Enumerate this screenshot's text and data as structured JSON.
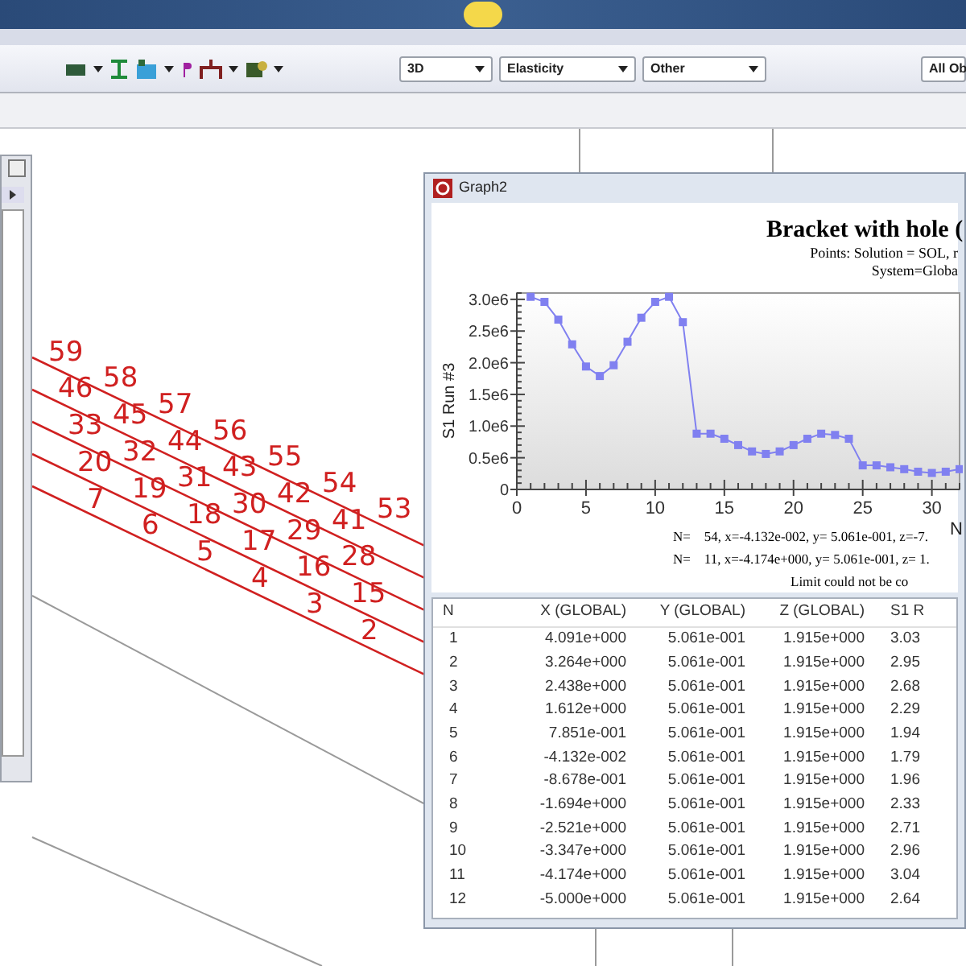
{
  "toolbar": {
    "dropdowns": [
      {
        "value": "3D"
      },
      {
        "value": "Elasticity"
      },
      {
        "value": "Other"
      },
      {
        "value": "All Ob"
      }
    ]
  },
  "viewport": {
    "node_label_rows": [
      [
        "59",
        "58",
        "57",
        "56",
        "55",
        "54",
        "53"
      ],
      [
        "46",
        "45",
        "44",
        "43",
        "42",
        "41"
      ],
      [
        "33",
        "32",
        "31",
        "30",
        "29",
        "28"
      ],
      [
        "20",
        "19",
        "18",
        "17",
        "16",
        "15"
      ],
      [
        "7",
        "6",
        "5",
        "4",
        "3",
        "2"
      ]
    ]
  },
  "graph_window": {
    "title": "Graph2",
    "heading": "Bracket with hole  (",
    "subtitle_lines": [
      "Points: Solution = SOL, r",
      "System=Globa"
    ],
    "chart_data": {
      "type": "line",
      "xlabel": "N",
      "ylabel": "S1 Run #3",
      "x": [
        1,
        2,
        3,
        4,
        5,
        6,
        7,
        8,
        9,
        10,
        11,
        12,
        13,
        14,
        15,
        16,
        17,
        18,
        19,
        20,
        21,
        22,
        23,
        24,
        25,
        26,
        27,
        28,
        29,
        30,
        31,
        32
      ],
      "series": [
        {
          "color": "#8080f0",
          "marker": "square",
          "values": [
            3040000,
            2960000,
            2680000,
            2290000,
            1940000,
            1790000,
            1960000,
            2330000,
            2710000,
            2960000,
            3040000,
            2640000,
            880000,
            880000,
            800000,
            700000,
            600000,
            560000,
            600000,
            700000,
            800000,
            880000,
            860000,
            800000,
            380000,
            380000,
            350000,
            320000,
            280000,
            260000,
            280000,
            320000
          ]
        }
      ],
      "xlim": [
        0,
        32
      ],
      "ylim": [
        0,
        3100000
      ],
      "xticks": [
        0,
        5,
        10,
        15,
        20,
        25,
        30
      ],
      "yticks": [
        {
          "value": 0,
          "label": "0"
        },
        {
          "value": 500000,
          "label": "0.5e6"
        },
        {
          "value": 1000000,
          "label": "1.0e6"
        },
        {
          "value": 1500000,
          "label": "1.5e6"
        },
        {
          "value": 2000000,
          "label": "2.0e6"
        },
        {
          "value": 2500000,
          "label": "2.5e6"
        },
        {
          "value": 3000000,
          "label": "3.0e6"
        }
      ]
    },
    "readouts": [
      "N=    54, x=-4.132e-002, y= 5.061e-001, z=-7.",
      "N=    11, x=-4.174e+000, y= 5.061e-001, z= 1.",
      "Limit could not be co"
    ],
    "table": {
      "columns": [
        "N",
        "X (GLOBAL)",
        "Y (GLOBAL)",
        "Z (GLOBAL)",
        "S1 R"
      ],
      "rows": [
        [
          "1",
          "4.091e+000",
          "5.061e-001",
          "1.915e+000",
          "3.03"
        ],
        [
          "2",
          "3.264e+000",
          "5.061e-001",
          "1.915e+000",
          "2.95"
        ],
        [
          "3",
          "2.438e+000",
          "5.061e-001",
          "1.915e+000",
          "2.68"
        ],
        [
          "4",
          "1.612e+000",
          "5.061e-001",
          "1.915e+000",
          "2.29"
        ],
        [
          "5",
          "7.851e-001",
          "5.061e-001",
          "1.915e+000",
          "1.94"
        ],
        [
          "6",
          "-4.132e-002",
          "5.061e-001",
          "1.915e+000",
          "1.79"
        ],
        [
          "7",
          "-8.678e-001",
          "5.061e-001",
          "1.915e+000",
          "1.96"
        ],
        [
          "8",
          "-1.694e+000",
          "5.061e-001",
          "1.915e+000",
          "2.33"
        ],
        [
          "9",
          "-2.521e+000",
          "5.061e-001",
          "1.915e+000",
          "2.71"
        ],
        [
          "10",
          "-3.347e+000",
          "5.061e-001",
          "1.915e+000",
          "2.96"
        ],
        [
          "11",
          "-4.174e+000",
          "5.061e-001",
          "1.915e+000",
          "3.04"
        ],
        [
          "12",
          "-5.000e+000",
          "5.061e-001",
          "1.915e+000",
          "2.64"
        ]
      ]
    }
  }
}
